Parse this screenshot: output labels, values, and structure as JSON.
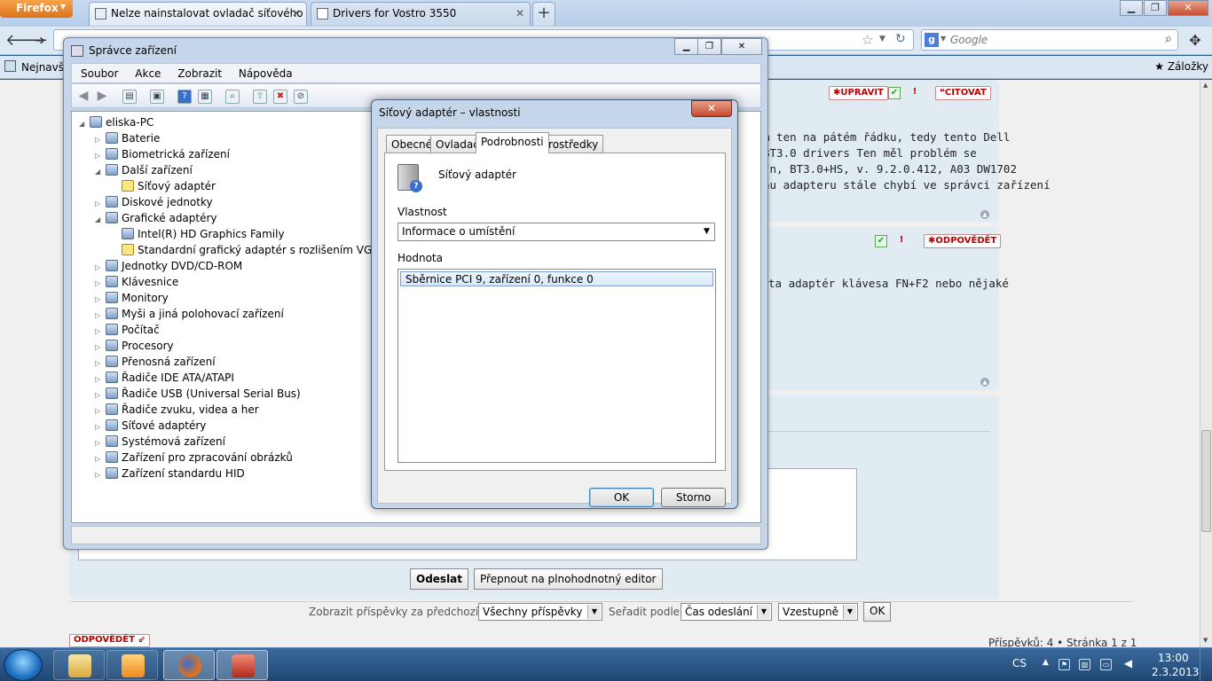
{
  "firefox": {
    "menu_label": "Firefox",
    "tabs": [
      {
        "title": "Nelze nainstalovat ovladač síťového a..."
      },
      {
        "title": "Drivers for Vostro 3550"
      }
    ],
    "new_tab": "+",
    "search_placeholder": "Google",
    "search_engine_letter": "g",
    "bookmarks_left": "Nejnavšt",
    "bookmarks_right": "Záložky"
  },
  "webpage": {
    "post1": {
      "buttons": {
        "edit": "UPRAVIT",
        "quote": "CITOVAT"
      },
      "lines": [
        "m ten na pátém řádku, tedy tento Dell",
        "BT3.0 drivers Ten měl problém se",
        "/n, BT3.0+HS, v. 9.2.0.412, A03 DW1702",
        "nu adapteru stále chybí ve správci zařízení"
      ]
    },
    "post2": {
      "buttons": {
        "reply": "ODPOVĚDĚT"
      },
      "lines": [
        "ta adaptér klávesa FN+F2 nebo nějaké"
      ]
    },
    "submit_label": "Odeslat",
    "full_editor_label": "Přepnout na plnohodnotný editor",
    "filter": {
      "show_label": "Zobrazit příspěvky za předchozí:",
      "show_value": "Všechny příspěvky",
      "sort_label": "Seřadit podle",
      "sort_value": "Čas odeslání",
      "order_value": "Vzestupně",
      "ok": "OK"
    },
    "bottom_reply": "ODPOVĚDĚT",
    "pagination": "Příspěvků: 4 • Stránka 1 z 1"
  },
  "device_manager": {
    "title": "Správce zařízení",
    "menu": [
      "Soubor",
      "Akce",
      "Zobrazit",
      "Nápověda"
    ],
    "tree": [
      {
        "label": "eliska-PC",
        "level": 0,
        "expander": "◢"
      },
      {
        "label": "Baterie",
        "level": 1,
        "expander": "▷"
      },
      {
        "label": "Biometrická zařízení",
        "level": 1,
        "expander": "▷"
      },
      {
        "label": "Další zařízení",
        "level": 1,
        "expander": "◢"
      },
      {
        "label": "Síťový adaptér",
        "level": 2,
        "expander": "",
        "warning": true
      },
      {
        "label": "Diskové jednotky",
        "level": 1,
        "expander": "▷"
      },
      {
        "label": "Grafické adaptéry",
        "level": 1,
        "expander": "◢"
      },
      {
        "label": "Intel(R) HD Graphics Family",
        "level": 2,
        "expander": ""
      },
      {
        "label": "Standardní grafický adaptér s rozlišením VGA",
        "level": 2,
        "expander": "",
        "warning": true
      },
      {
        "label": "Jednotky DVD/CD-ROM",
        "level": 1,
        "expander": "▷"
      },
      {
        "label": "Klávesnice",
        "level": 1,
        "expander": "▷"
      },
      {
        "label": "Monitory",
        "level": 1,
        "expander": "▷"
      },
      {
        "label": "Myši a jiná polohovací zařízení",
        "level": 1,
        "expander": "▷"
      },
      {
        "label": "Počítač",
        "level": 1,
        "expander": "▷"
      },
      {
        "label": "Procesory",
        "level": 1,
        "expander": "▷"
      },
      {
        "label": "Přenosná zařízení",
        "level": 1,
        "expander": "▷"
      },
      {
        "label": "Řadiče IDE ATA/ATAPI",
        "level": 1,
        "expander": "▷"
      },
      {
        "label": "Řadiče USB (Universal Serial Bus)",
        "level": 1,
        "expander": "▷"
      },
      {
        "label": "Řadiče zvuku, videa a her",
        "level": 1,
        "expander": "▷"
      },
      {
        "label": "Síťové adaptéry",
        "level": 1,
        "expander": "▷"
      },
      {
        "label": "Systémová zařízení",
        "level": 1,
        "expander": "▷"
      },
      {
        "label": "Zařízení pro zpracování obrázků",
        "level": 1,
        "expander": "▷"
      },
      {
        "label": "Zařízení standardu HID",
        "level": 1,
        "expander": "▷"
      }
    ]
  },
  "properties": {
    "title": "Síťový adaptér – vlastnosti",
    "close": "✕",
    "tabs": [
      "Obecné",
      "Ovladač",
      "Podrobnosti",
      "Prostředky"
    ],
    "active_tab": "Podrobnosti",
    "device_name": "Síťový adaptér",
    "property_label": "Vlastnost",
    "property_value": "Informace o umístění",
    "value_label": "Hodnota",
    "value_item": "Sběrnice PCI 9, zařízení 0, funkce 0",
    "ok": "OK",
    "cancel": "Storno"
  },
  "taskbar": {
    "lang": "CS",
    "time": "13:00",
    "date": "2.3.2013"
  }
}
